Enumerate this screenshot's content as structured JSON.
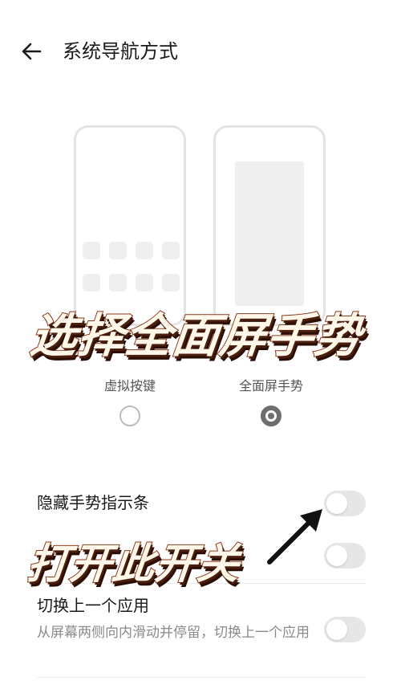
{
  "header": {
    "title": "系统导航方式",
    "back_icon": "arrow-left-icon"
  },
  "options": [
    {
      "label": "虚拟按键",
      "selected": false
    },
    {
      "label": "全面屏手势",
      "selected": true
    }
  ],
  "overlays": {
    "main_caption": "选择全面屏手势",
    "toggle_caption": "打开此开关"
  },
  "settings": [
    {
      "title": "隐藏手势指示条",
      "toggle_on": false
    },
    {
      "title": "",
      "toggle_on": false
    },
    {
      "title": "切换上一个应用",
      "description": "从屏幕两侧向内滑动并停留，切换上一个应用",
      "toggle_on": false
    }
  ],
  "colors": {
    "overlay_fill": "#fff8ea",
    "overlay_stroke": "#8a3a1e",
    "toggle_off": "#e6e6e6",
    "radio_selected": "#6e6e6e"
  }
}
